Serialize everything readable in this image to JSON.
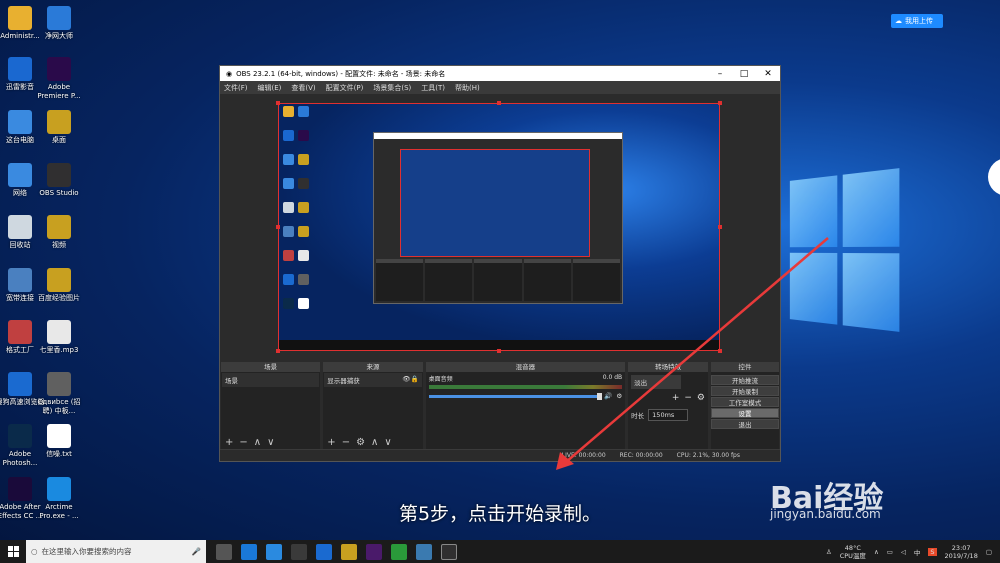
{
  "desktop": {
    "icons": [
      {
        "label": "Administr...",
        "color": "#e8b030"
      },
      {
        "label": "净网大师",
        "color": "#2a7ad8"
      },
      {
        "label": "迅雷影音",
        "color": "#1a68d0"
      },
      {
        "label": "Adobe Premiere P...",
        "color": "#2a0a4a"
      },
      {
        "label": "这台电脑",
        "color": "#3a8ae0"
      },
      {
        "label": "桌面",
        "color": "#c8a020"
      },
      {
        "label": "网络",
        "color": "#3a8ae0"
      },
      {
        "label": "OBS Studio",
        "color": "#302f30"
      },
      {
        "label": "回收站",
        "color": "#cfd8e0"
      },
      {
        "label": "视频",
        "color": "#c8a020"
      },
      {
        "label": "宽带连接",
        "color": "#4a80c0"
      },
      {
        "label": "百度经验图片",
        "color": "#c8a020"
      },
      {
        "label": "格式工厂",
        "color": "#c04040"
      },
      {
        "label": "七里香.mp3",
        "color": "#e8e8e8"
      },
      {
        "label": "搜狗高速浏览器",
        "color": "#1a6ad0"
      },
      {
        "label": "Cдвиbce (招聘) 中板...",
        "color": "#606060"
      },
      {
        "label": "Adobe Photosh...",
        "color": "#0a2a4a"
      },
      {
        "label": "信噪.txt",
        "color": "#ffffff"
      },
      {
        "label": "Adobe After Effects CC ...",
        "color": "#1a0a3a"
      },
      {
        "label": "Arctime Pro.exe - ...",
        "color": "#1a8ae0"
      }
    ],
    "upload_label": "我用上传",
    "subtitle": "第5步，点击开始录制。",
    "watermark_brand": "Bai经验",
    "watermark_url": "jingyan.baidu.com"
  },
  "obs": {
    "title": "OBS 23.2.1 (64-bit, windows) - 配置文件: 未命名 - 场景: 未命名",
    "menu": [
      "文件(F)",
      "编辑(E)",
      "查看(V)",
      "配置文件(P)",
      "场景集合(S)",
      "工具(T)",
      "帮助(H)"
    ],
    "docks": {
      "scenes": {
        "title": "场景",
        "items": [
          "场景"
        ]
      },
      "sources": {
        "title": "来源",
        "items": [
          "显示器捕获"
        ]
      },
      "mixer": {
        "title": "混音器",
        "track_name": "桌面音频",
        "db": "0.0 dB"
      },
      "transitions": {
        "title": "转场特效",
        "selected": "淡出",
        "duration_label": "时长",
        "duration_value": "150ms"
      },
      "controls": {
        "title": "控件",
        "buttons": [
          "开始推流",
          "开始录制",
          "工作室模式",
          "设置",
          "退出"
        ]
      }
    },
    "status": {
      "live": "LIVE: 00:00:00",
      "rec": "REC: 00:00:00",
      "cpu": "CPU: 2.1%, 30.00 fps"
    }
  },
  "taskbar": {
    "search_placeholder": "在这里输入你要搜索的内容",
    "temp": "48°C",
    "temp_label": "CPU温度",
    "time": "23:07",
    "date": "2019/7/18"
  }
}
